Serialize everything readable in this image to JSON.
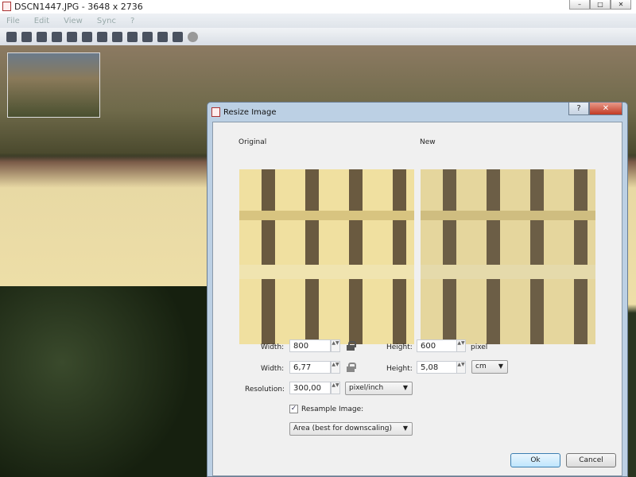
{
  "window": {
    "title": "DSCN1447.JPG - 3648 x 2736",
    "min": "–",
    "max": "□",
    "close": "✕"
  },
  "menu": [
    "File",
    "Edit",
    "View",
    "Sync",
    "?"
  ],
  "dialog": {
    "title": "Resize Image",
    "help": "?",
    "close": "✕",
    "original_label": "Original",
    "new_label": "New",
    "pixel_row": {
      "width_label": "Width:",
      "width": "800",
      "height_label": "Height:",
      "height": "600",
      "unit": "pixel"
    },
    "size_row": {
      "width_label": "Width:",
      "width": "6,77",
      "height_label": "Height:",
      "height": "5,08",
      "unit": "cm"
    },
    "resolution": {
      "label": "Resolution:",
      "value": "300,00",
      "unit": "pixel/inch"
    },
    "resample": {
      "label": "Resample Image:",
      "checked": true,
      "check": "✓",
      "method": "Area (best for downscaling)"
    },
    "ok": "Ok",
    "cancel": "Cancel",
    "arrow": "▼",
    "spin": "▲▼"
  }
}
